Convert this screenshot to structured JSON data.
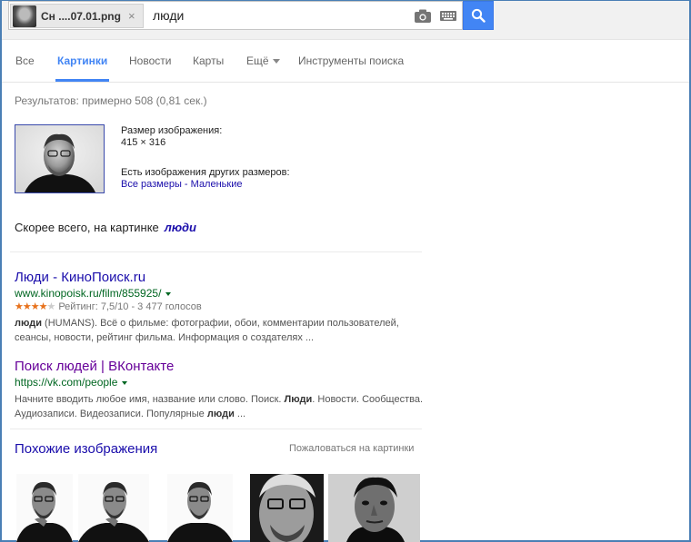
{
  "search": {
    "image_chip_label": "Сн ....07.01.png",
    "chip_close": "×",
    "query": "люди"
  },
  "icons": {
    "camera": "camera-icon",
    "keyboard": "keyboard-icon",
    "search": "search-icon",
    "close": "close-icon"
  },
  "tabs": [
    {
      "label": "Все",
      "active": false
    },
    {
      "label": "Картинки",
      "active": true
    },
    {
      "label": "Новости",
      "active": false
    },
    {
      "label": "Карты",
      "active": false
    },
    {
      "label": "Ещё",
      "active": false
    },
    {
      "label": "Инструменты поиска",
      "active": false
    }
  ],
  "results_count": "Результатов: примерно 508 (0,81 сек.)",
  "image_info": {
    "size_label": "Размер изображения:",
    "size_value": "415 × 316",
    "other_sizes_label": "Есть изображения других размеров:",
    "all_sizes": "Все размеры",
    "separator": " - ",
    "small": "Маленькие"
  },
  "best_guess": {
    "prefix": "Скорее всего, на картинке",
    "term": "люди"
  },
  "results": [
    {
      "title": "Люди - КиноПоиск.ru",
      "url": "www.kinopoisk.ru/film/855925/",
      "rating_stars": 4,
      "rating_text": "Рейтинг: 7,5/10 - 3 477 голосов",
      "snippet_bold": "люди",
      "snippet_rest": " (HUMANS). Всё о фильме: фотографии, обои, комментарии пользователей, сеансы, новости, рейтинг фильма. Информация о создателях ..."
    },
    {
      "title": "Поиск людей | ВКонтакте",
      "url": "https://vk.com/people",
      "snippet_pre": "Начните вводить любое имя, название или слово. Поиск. ",
      "snippet_bold1": "Люди",
      "snippet_mid": ". Новости. Сообщества. Аудиозаписи. Видеозаписи. Популярные ",
      "snippet_bold2": "люди",
      "snippet_post": " ..."
    }
  ],
  "similar": {
    "title": "Похожие изображения",
    "report": "Пожаловаться на картинки"
  },
  "colors": {
    "accent": "#4285f4",
    "link": "#1a0dab",
    "visited": "#660099",
    "url": "#006621",
    "star": "#e7711b"
  }
}
